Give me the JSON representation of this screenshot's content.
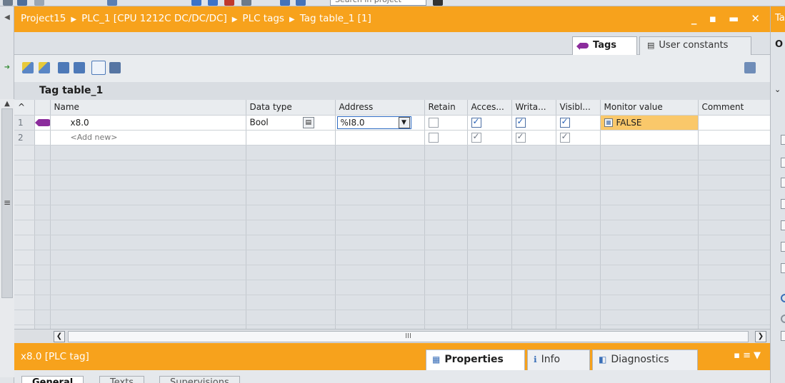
{
  "topbar": {
    "search_placeholder": "Search in project"
  },
  "editor": {
    "breadcrumb": [
      "Project15",
      "PLC_1 [CPU 1212C DC/DC/DC]",
      "PLC tags",
      "Tag table_1 [1]"
    ],
    "window_controls": "_ ▪ ▬ ✕",
    "tabs": [
      {
        "label": "Tags",
        "active": true
      },
      {
        "label": "User constants",
        "active": false
      }
    ],
    "table_name": "Tag table_1"
  },
  "grid": {
    "columns": [
      "",
      "",
      "Name",
      "Data type",
      "Address",
      "Retain",
      "Acces...",
      "Writa...",
      "Visibl...",
      "Monitor value",
      "Comment"
    ],
    "rows": [
      {
        "num": "1",
        "name": "x8.0",
        "data_type": "Bool",
        "address": "%I8.0",
        "retain": false,
        "accessible": true,
        "writable": true,
        "visible": true,
        "monitor": "FALSE",
        "comment": ""
      },
      {
        "num": "2",
        "name": "<Add new>",
        "data_type": "",
        "address": "",
        "retain": false,
        "accessible": true,
        "writable": true,
        "visible": true,
        "monitor": "",
        "comment": ""
      }
    ],
    "hscroll_grip": "III"
  },
  "inspector": {
    "title": "x8.0 [PLC tag]",
    "tabs": [
      {
        "label": "Properties",
        "active": true
      },
      {
        "label": "Info",
        "active": false
      },
      {
        "label": "Diagnostics",
        "active": false
      }
    ],
    "subtabs": [
      "General",
      "Texts",
      "Supervisions"
    ]
  },
  "right_panel": {
    "title_initial": "Ta",
    "section_initial": "O"
  },
  "colors": {
    "title_orange": "#f7a21c",
    "monitor_bg": "#fac86a",
    "tag_icon": "#8b2c9c"
  }
}
